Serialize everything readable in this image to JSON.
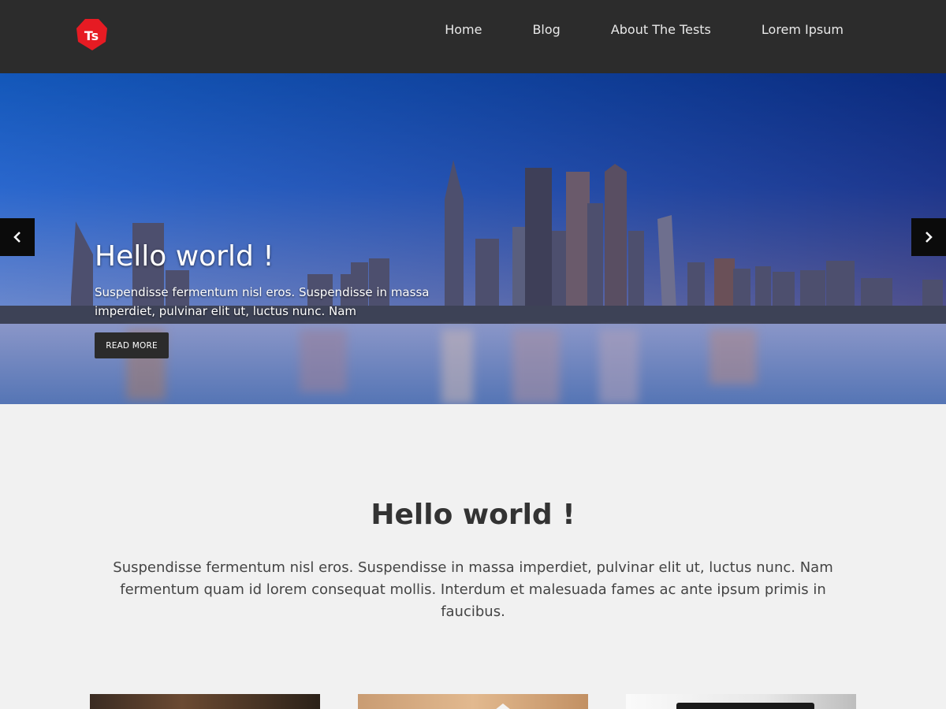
{
  "header": {
    "logo_text": "Ts",
    "brand_color": "#e61b23",
    "nav": [
      {
        "label": "Home"
      },
      {
        "label": "Blog"
      },
      {
        "label": "About The Tests"
      },
      {
        "label": "Lorem Ipsum"
      }
    ]
  },
  "hero": {
    "title": "Hello world !",
    "text": "Suspendisse fermentum nisl eros. Suspendisse in massa imperdiet, pulvinar elit ut, luctus nunc. Nam",
    "button_label": "READ MORE",
    "prev_icon": "chevron-left-icon",
    "next_icon": "chevron-right-icon"
  },
  "intro": {
    "title": "Hello world !",
    "text": "Suspendisse fermentum nisl eros. Suspendisse in massa imperdiet, pulvinar elit ut, luctus nunc. Nam fermentum quam id lorem consequat mollis. Interdum et malesuada fames ac ante ipsum primis in faucibus."
  }
}
